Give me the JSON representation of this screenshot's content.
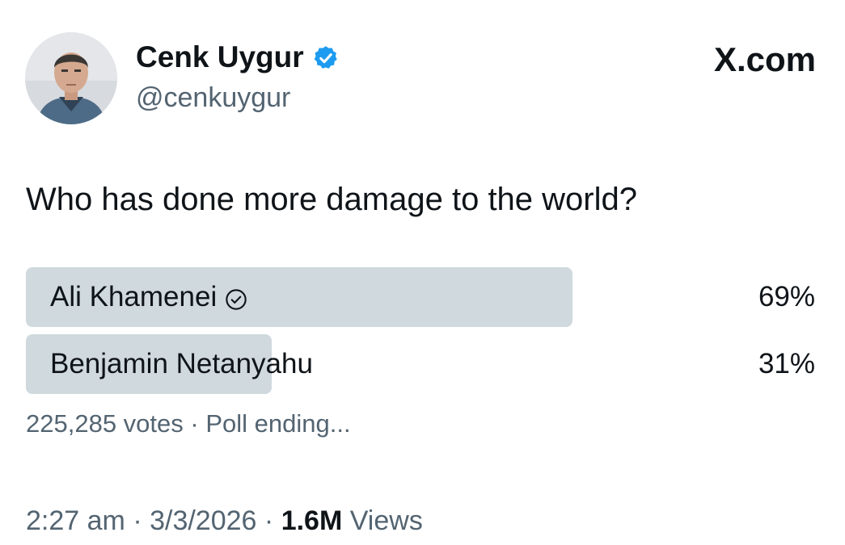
{
  "author": {
    "display_name": "Cenk Uygur",
    "handle": "@cenkuygur",
    "verified_icon": "verified-badge-icon",
    "verified_color": "#1d9bf0"
  },
  "brand": "X.com",
  "tweet": {
    "question": "Who has done more damage to the world?"
  },
  "poll": {
    "options": [
      {
        "label": "Ali Khamenei",
        "percent": "69%",
        "share": 0.69,
        "winner": true,
        "winner_icon": "check-circle-icon"
      },
      {
        "label": "Benjamin Netanyahu",
        "percent": "31%",
        "share": 0.31,
        "winner": false
      }
    ],
    "votes": "225,285 votes",
    "separator": "·",
    "status": "Poll ending..."
  },
  "footer": {
    "time": "2:27 am",
    "date": "3/3/2026",
    "separator": "·",
    "views_count": "1.6M",
    "views_label": "Views"
  },
  "colors": {
    "text_primary": "#0f1419",
    "text_secondary": "#536471",
    "poll_bar": "#cfd9de"
  }
}
